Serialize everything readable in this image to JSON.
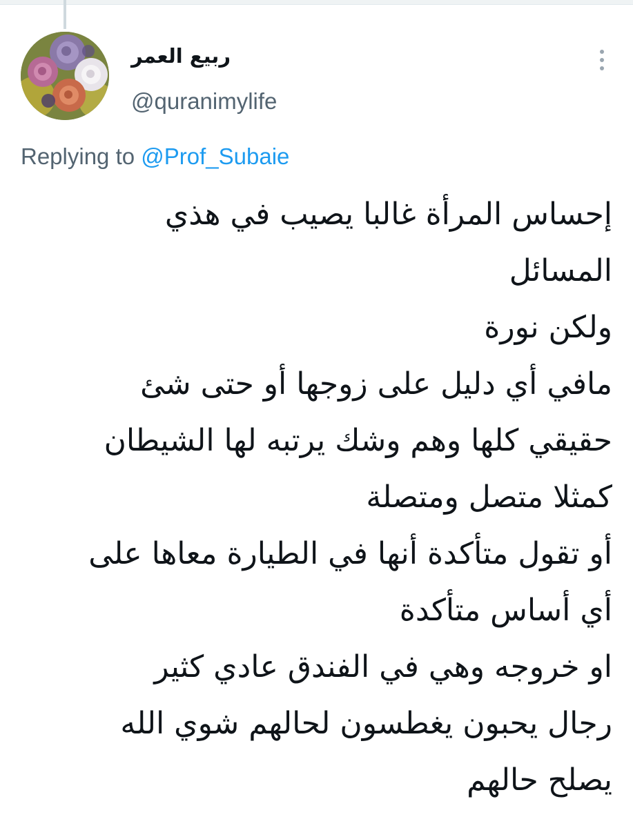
{
  "tweet": {
    "display_name": "ربيع العمر",
    "handle": "@quranimylife",
    "avatar_icon": "roses-avatar-icon",
    "more_icon": "more-vertical-icon",
    "replying_prefix": "Replying to",
    "replying_mention": "@Prof_Subaie",
    "body_lines": [
      "إحساس المرأة غالبا يصيب في هذي",
      "المسائل",
      "ولكن نورة",
      "مافي أي دليل على زوجها أو حتى شئ",
      "حقيقي كلها وهم وشك يرتبه لها الشيطان",
      "كمثلا متصل ومتصلة",
      "أو تقول متأكدة أنها في الطيارة معاها على",
      "أي أساس متأكدة",
      "او خروجه وهي في الفندق عادي كثير",
      "رجال يحبون يغطسون لحالهم شوي  الله",
      "يصلح حالهم"
    ]
  },
  "colors": {
    "text_primary": "#0f1419",
    "text_secondary": "#536471",
    "link": "#1d9bf0",
    "thread_line": "#cfd9de"
  }
}
